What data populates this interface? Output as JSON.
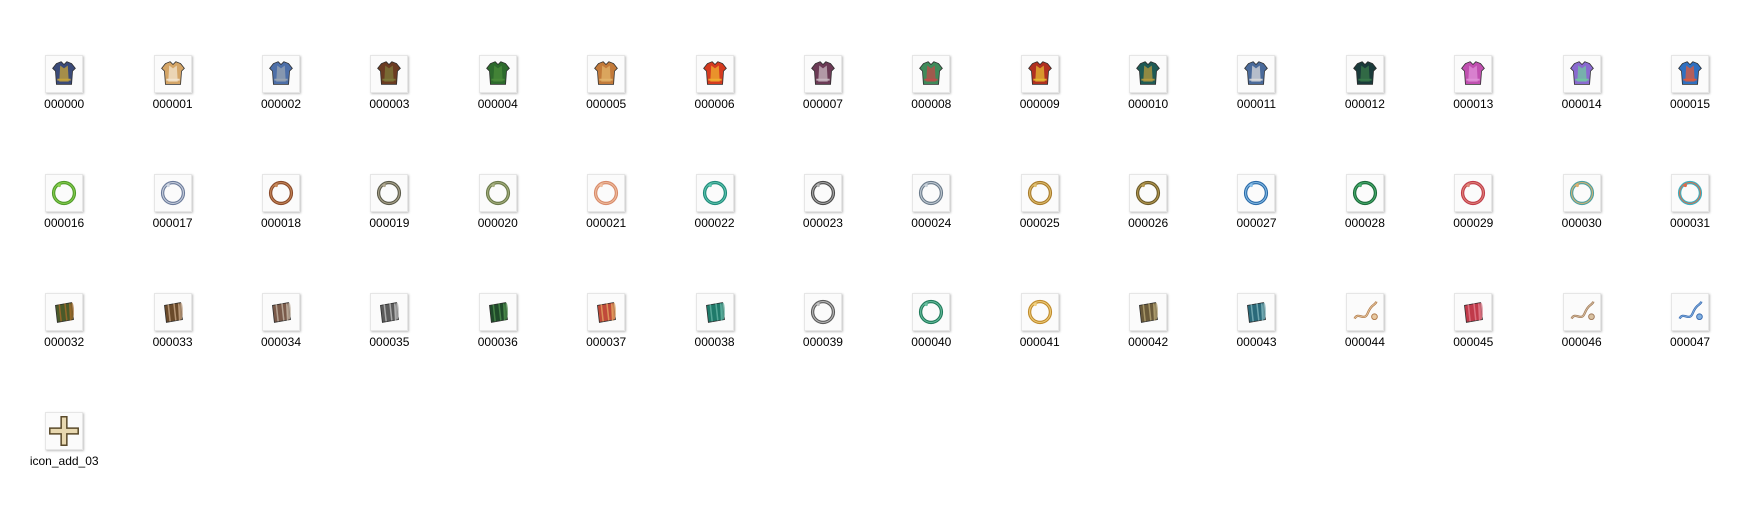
{
  "folder": {
    "items": [
      {
        "label": "000000",
        "kind": "armor",
        "c1": "#3a4a78",
        "c2": "#c9a53a"
      },
      {
        "label": "000001",
        "kind": "armor",
        "c1": "#d4a567",
        "c2": "#f3e6cf"
      },
      {
        "label": "000002",
        "kind": "armor",
        "c1": "#4d6fa8",
        "c2": "#9aa4b2"
      },
      {
        "label": "000003",
        "kind": "armor",
        "c1": "#6a3b22",
        "c2": "#7d7a3a"
      },
      {
        "label": "000004",
        "kind": "armor",
        "c1": "#2d6a2d",
        "c2": "#4a8b3a"
      },
      {
        "label": "000005",
        "kind": "armor",
        "c1": "#c27a3a",
        "c2": "#e2b46a"
      },
      {
        "label": "000006",
        "kind": "armor",
        "c1": "#d43a1f",
        "c2": "#f0b030"
      },
      {
        "label": "000007",
        "kind": "armor",
        "c1": "#6b3a55",
        "c2": "#c9b8c2"
      },
      {
        "label": "000008",
        "kind": "armor",
        "c1": "#3f8a5a",
        "c2": "#c04a4a"
      },
      {
        "label": "000009",
        "kind": "armor",
        "c1": "#b03020",
        "c2": "#e6b830"
      },
      {
        "label": "000010",
        "kind": "armor",
        "c1": "#1f5a55",
        "c2": "#b79a3c"
      },
      {
        "label": "000011",
        "kind": "armor",
        "c1": "#4a6a9a",
        "c2": "#d9d9d9"
      },
      {
        "label": "000012",
        "kind": "armor",
        "c1": "#1a3a3a",
        "c2": "#3a7a4a"
      },
      {
        "label": "000013",
        "kind": "armor",
        "c1": "#c050b0",
        "c2": "#e090d8"
      },
      {
        "label": "000014",
        "kind": "armor",
        "c1": "#8a6ad0",
        "c2": "#70c8a0"
      },
      {
        "label": "000015",
        "kind": "armor",
        "c1": "#3070c0",
        "c2": "#e05a3a"
      },
      {
        "label": "000016",
        "kind": "ring",
        "c1": "#4f9a2a",
        "c2": "#8ad050"
      },
      {
        "label": "000017",
        "kind": "ring",
        "c1": "#6a7a9a",
        "c2": "#cfd6e2"
      },
      {
        "label": "000018",
        "kind": "ring",
        "c1": "#8a4a2a",
        "c2": "#c88a5a"
      },
      {
        "label": "000019",
        "kind": "ring",
        "c1": "#5a5a4a",
        "c2": "#b0a890"
      },
      {
        "label": "000020",
        "kind": "ring",
        "c1": "#6a7a4a",
        "c2": "#a8b080"
      },
      {
        "label": "000021",
        "kind": "ring",
        "c1": "#d88a6a",
        "c2": "#f0c0a0"
      },
      {
        "label": "000022",
        "kind": "ring",
        "c1": "#1f8a7a",
        "c2": "#60c8b0"
      },
      {
        "label": "000023",
        "kind": "ring",
        "c1": "#4a4a4a",
        "c2": "#b0b0b0"
      },
      {
        "label": "000024",
        "kind": "ring",
        "c1": "#6a7a8a",
        "c2": "#c8d0d8"
      },
      {
        "label": "000025",
        "kind": "ring",
        "c1": "#a87a2a",
        "c2": "#e0c070"
      },
      {
        "label": "000026",
        "kind": "ring",
        "c1": "#6a5a2a",
        "c2": "#b89a50"
      },
      {
        "label": "000027",
        "kind": "ring",
        "c1": "#2a6aa8",
        "c2": "#8ac0e8"
      },
      {
        "label": "000028",
        "kind": "ring",
        "c1": "#1a6a3a",
        "c2": "#4ab070"
      },
      {
        "label": "000029",
        "kind": "ring",
        "c1": "#c03a4a",
        "c2": "#e08a7a"
      },
      {
        "label": "000030",
        "kind": "ring",
        "c1": "#4aa0a0",
        "c2": "#e0b070"
      },
      {
        "label": "000031",
        "kind": "ring",
        "c1": "#3ab0c0",
        "c2": "#e06a4a"
      },
      {
        "label": "000032",
        "kind": "bracer",
        "c1": "#4a5a2a",
        "c2": "#a06a2a"
      },
      {
        "label": "000033",
        "kind": "bracer",
        "c1": "#6a4a2a",
        "c2": "#c0a080"
      },
      {
        "label": "000034",
        "kind": "bracer",
        "c1": "#7a5a4a",
        "c2": "#c0b0a0"
      },
      {
        "label": "000035",
        "kind": "bracer",
        "c1": "#5a5a5a",
        "c2": "#b8b8b8"
      },
      {
        "label": "000036",
        "kind": "bracer",
        "c1": "#1f4a2a",
        "c2": "#4a8a4a"
      },
      {
        "label": "000037",
        "kind": "bracer",
        "c1": "#c04a3a",
        "c2": "#e0a060"
      },
      {
        "label": "000038",
        "kind": "bracer",
        "c1": "#1f7a6a",
        "c2": "#60b0a0"
      },
      {
        "label": "000039",
        "kind": "ring",
        "c1": "#5a5a5a",
        "c2": "#c0c0c0"
      },
      {
        "label": "000040",
        "kind": "ring",
        "c1": "#1f7a5a",
        "c2": "#6ac0a0"
      },
      {
        "label": "000041",
        "kind": "ring",
        "c1": "#c08a2a",
        "c2": "#f0d080"
      },
      {
        "label": "000042",
        "kind": "bracer",
        "c1": "#6a5a3a",
        "c2": "#b0a070"
      },
      {
        "label": "000043",
        "kind": "bracer",
        "c1": "#2a6a7a",
        "c2": "#7ab0b8"
      },
      {
        "label": "000044",
        "kind": "chain",
        "c1": "#b07a4a",
        "c2": "#e8c8a0"
      },
      {
        "label": "000045",
        "kind": "bracer",
        "c1": "#c03a4a",
        "c2": "#e07a8a"
      },
      {
        "label": "000046",
        "kind": "chain",
        "c1": "#a07a5a",
        "c2": "#d8c0a0"
      },
      {
        "label": "000047",
        "kind": "chain",
        "c1": "#3a6ab0",
        "c2": "#80b0e0"
      },
      {
        "label": "icon_add_03",
        "kind": "add",
        "c1": "#5a4a2a",
        "c2": "#e8d8b0"
      }
    ]
  }
}
